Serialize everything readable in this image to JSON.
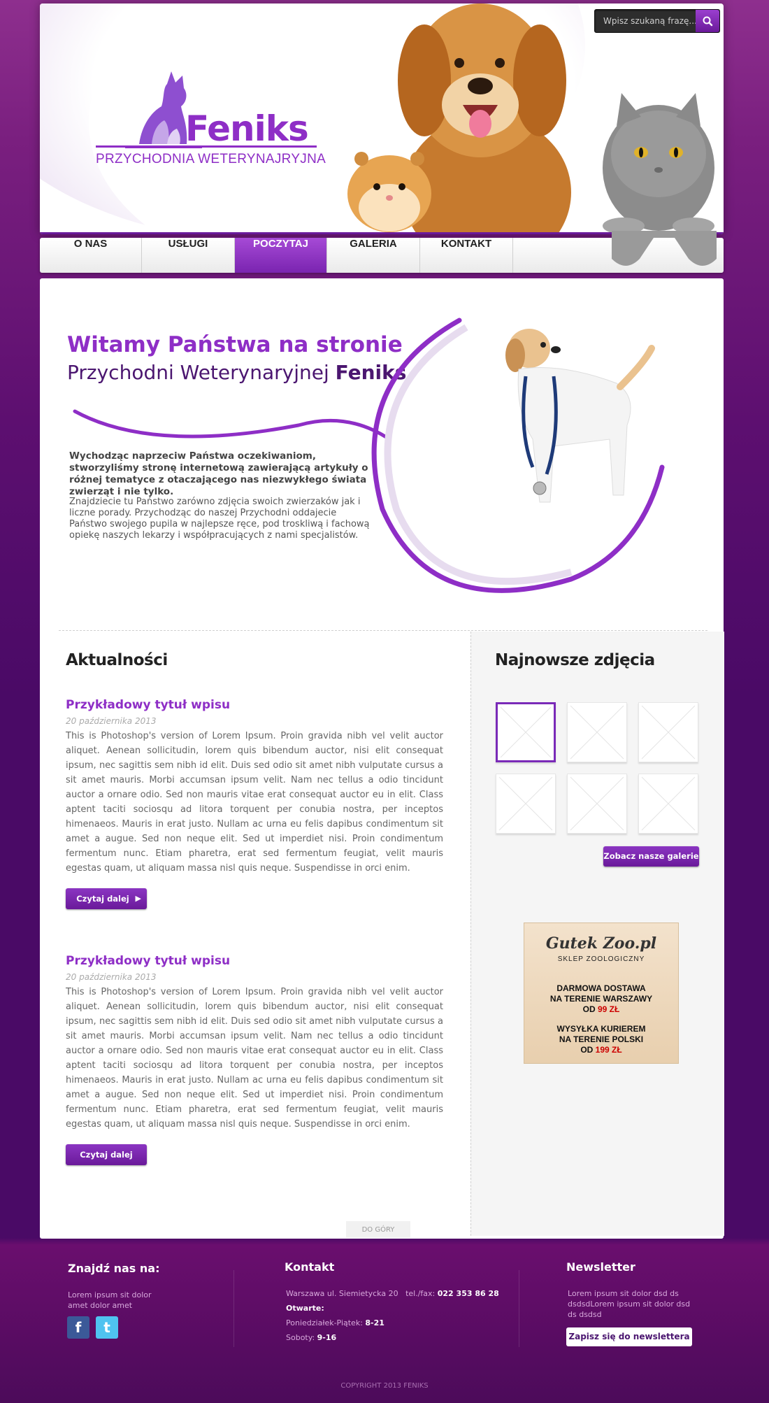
{
  "search": {
    "placeholder": "Wpisz szukaną frazę..."
  },
  "logo": {
    "name": "Feniks",
    "subtitle": "PRZYCHODNIA WETERYNAJRYJNA"
  },
  "nav": [
    {
      "label": "O NAS",
      "active": false
    },
    {
      "label": "USŁUGI",
      "active": false
    },
    {
      "label": "POCZYTAJ",
      "active": true
    },
    {
      "label": "GALERIA",
      "active": false
    },
    {
      "label": "KONTAKT",
      "active": false
    }
  ],
  "welcome": {
    "line1": "Witamy Państwa na stronie",
    "line2_prefix": "Przychodni Weterynaryjnej ",
    "line2_bold": "Feniks",
    "intro_bold": "Wychodząc naprzeciw Państwa oczekiwaniom, stworzyliśmy stronę internetową zawierającą artykuły o różnej tematyce z otaczającego nas niezwykłego świata zwierząt i nie tylko.",
    "intro": "Znajdziecie tu Państwo zarówno zdjęcia swoich zwierzaków jak i liczne porady. Przychodząc do naszej Przychodni oddajecie Państwo swojego pupila w najlepsze ręce, pod troskliwą i fachową opiekę naszych lekarzy i współpracujących z nami specjalistów."
  },
  "news": {
    "heading": "Aktualności",
    "posts": [
      {
        "title": "Przykładowy tytuł wpisu",
        "date": "20 października 2013",
        "body": "This is Photoshop's version  of Lorem Ipsum. Proin gravida nibh vel velit auctor aliquet. Aenean sollicitudin, lorem quis bibendum auctor, nisi elit consequat ipsum, nec sagittis sem nibh id elit. Duis sed odio sit amet nibh vulputate cursus a sit amet mauris. Morbi accumsan ipsum velit. Nam nec tellus a odio tincidunt auctor a ornare odio. Sed non mauris vitae erat consequat auctor eu in elit. Class aptent taciti sociosqu ad litora torquent per conubia nostra, per inceptos himenaeos. Mauris in erat justo. Nullam ac urna eu felis dapibus condimentum sit amet a augue. Sed non neque elit. Sed ut imperdiet nisi. Proin condimentum fermentum nunc. Etiam pharetra, erat sed fermentum feugiat, velit mauris egestas quam, ut aliquam massa nisl quis neque. Suspendisse in orci enim.",
        "button": "Czytaj dalej"
      },
      {
        "title": "Przykładowy tytuł wpisu",
        "date": "20 października 2013",
        "body": "This is Photoshop's version  of Lorem Ipsum. Proin gravida nibh vel velit auctor aliquet. Aenean sollicitudin, lorem quis bibendum auctor, nisi elit consequat ipsum, nec sagittis sem nibh id elit. Duis sed odio sit amet nibh vulputate cursus a sit amet mauris. Morbi accumsan ipsum velit. Nam nec tellus a odio tincidunt auctor a ornare odio. Sed non mauris vitae erat consequat auctor eu in elit. Class aptent taciti sociosqu ad litora torquent per conubia nostra, per inceptos himenaeos. Mauris in erat justo. Nullam ac urna eu felis dapibus condimentum sit amet a augue. Sed non neque elit. Sed ut imperdiet nisi. Proin condimentum fermentum nunc. Etiam pharetra, erat sed fermentum feugiat, velit mauris egestas quam, ut aliquam massa nisl quis neque. Suspendisse in orci enim.",
        "button": "Czytaj dalej"
      }
    ]
  },
  "photos": {
    "heading": "Najnowsze zdjęcia",
    "button": "Zobacz nasze galerie"
  },
  "ad": {
    "logo": "Gutek Zoo.pl",
    "subtitle": "SKLEP ZOOLOGICZNY",
    "line1": "DARMOWA DOSTAWA",
    "line2": "NA TERENIE WARSZAWY",
    "line3_prefix": "OD ",
    "line3_price": "99 ZŁ",
    "line4": "WYSYŁKA KURIEREM",
    "line5": "NA TERENIE POLSKI",
    "line6_prefix": "OD ",
    "line6_price": "199 ZŁ"
  },
  "to_top": "DO GÓRY",
  "footer": {
    "find": {
      "heading": "Znajdź nas na:",
      "text": "Lorem ipsum sit dolor amet dolor amet"
    },
    "contact": {
      "heading": "Kontakt",
      "address": "Warszawa ul. Siemietycka 20",
      "phone_label": "tel./fax:",
      "phone": "022 353 86 28",
      "open_label": "Otwarte:",
      "weekdays_label": "Poniedziałek-Piątek:",
      "weekdays_hours": "8-21",
      "saturday_label": "Soboty:",
      "saturday_hours": "9-16"
    },
    "newsletter": {
      "heading": "Newsletter",
      "text": "Lorem ipsum sit dolor dsd ds dsdsdLorem ipsum sit dolor dsd ds dsdsd",
      "button": "Zapisz się do newslettera"
    },
    "copyright": "COPYRIGHT 2013 FENIKS"
  },
  "colors": {
    "accent": "#8e2ec6",
    "dark_purple": "#4b1670",
    "page_bg": "#5d0f70"
  },
  "icons": [
    "search-icon",
    "facebook-icon",
    "twitter-icon",
    "arrow-right-icon"
  ]
}
